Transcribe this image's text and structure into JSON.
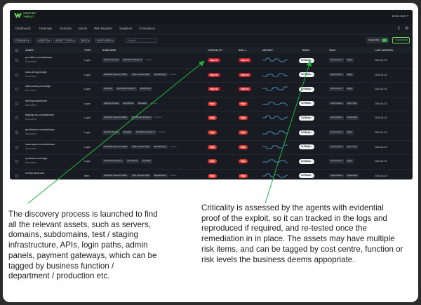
{
  "app": {
    "brand_line1": "VERIFIED",
    "brand_line2": "THREAT",
    "user_menu": "Demo User ▾"
  },
  "nav": [
    "Dashboard",
    "Heatmap",
    "Domains",
    "Assets",
    "Risk Register",
    "Suppliers",
    "Compliance"
  ],
  "nav_icons": [
    "key-icon",
    "gear-icon"
  ],
  "filters": {
    "buttons": [
      "DOMAINS ▾",
      "ASSETS ▾",
      "ASSET TYPES ▾",
      "TAGS ▾",
      "SUPPLIERS ▾"
    ],
    "search_placeholder": "Search...",
    "discovery_label": "Discovery",
    "add_asset_label": "+ Add Asset"
  },
  "columns": [
    "ASSET ↑",
    "TYPE ↑",
    "SUPPLIERS",
    "CRITICALITY",
    "RISK ▾",
    "HISTORY",
    "RISKS",
    "TAGS",
    "LAST UPDATED ↑"
  ],
  "colors": {
    "high": "#d9352b",
    "highest": "#c8202a",
    "accent": "#6ad15a",
    "arrow": "#1fb33b"
  },
  "rows": [
    {
      "asset": "pm-office.com/auth/user",
      "status": "Discovered",
      "type": "Login",
      "suppliers": [
        "Apache Tomcat",
        "WordPress Plugin V"
      ],
      "more": "6 more...",
      "criticality": "Highest",
      "risk": "Highest",
      "risks": "12 Risks",
      "tags": [
        "Cost Code A",
        "Edge"
      ],
      "updated": "2024-04-15"
    },
    {
      "asset": "www.citrx.gov/login",
      "status": "Discovered",
      "type": "Login",
      "suppliers": [
        "ASP.NET (Generic WAF)",
        "ASP Generic WAF",
        "ModSecurity"
      ],
      "more": "4 more...",
      "criticality": "Highest",
      "risk": "Highest",
      "risks": "12 Risks",
      "tags": [
        "Cost Code A",
        "Edge"
      ],
      "updated": "2024-04-15"
    },
    {
      "asset": "www.country.com/login",
      "status": "Discovered",
      "type": "Login",
      "suppliers": [
        "Redislite",
        "WordPress Plugin 3",
        "WordPress"
      ],
      "more": "",
      "criticality": "Highest",
      "risk": "Highest",
      "risks": "12 Risks",
      "tags": [
        "Cost Code A",
        "Edge"
      ],
      "updated": "2024-04-15"
    },
    {
      "asset": "electi.gov/auth/user",
      "status": "Discovered",
      "type": "Login",
      "suppliers": [
        "Apache Tomcat",
        "WordPress",
        "Redislite"
      ],
      "more": "4 more...",
      "criticality": "High",
      "risk": "High",
      "risks": "12 Risks",
      "tags": [
        "Cost Code A",
        "Test / Dev"
      ],
      "updated": "2024-04-15"
    },
    {
      "asset": "flagship.ws.com/auth/user",
      "status": "Discovered",
      "type": "Login",
      "suppliers": [
        "ASP.NET (Generic WAF)",
        "WordPress Plugin B"
      ],
      "more": "6 more...",
      "criticality": "High",
      "risk": "High",
      "risks": "14 Risks",
      "tags": [
        "Cost Code A",
        "Production"
      ],
      "updated": "2024-04-15"
    },
    {
      "asset": "gov.finance.com/auth/user",
      "status": "Discovered",
      "type": "Login",
      "suppliers": [
        "Apache Tomcat",
        "Redislite",
        "WordPress Plugin V"
      ],
      "more": "6 more...",
      "criticality": "High",
      "risk": "High",
      "risks": "12 Risks",
      "tags": [
        "Cost Code A",
        "Edge"
      ],
      "updated": "2024-04-15"
    },
    {
      "asset": "www.airport.com/auth/user",
      "status": "Discovered",
      "type": "Login",
      "suppliers": [
        "ASP.NET (Generic WAF)",
        "ASP Generic WAF",
        "ModSecurity"
      ],
      "more": "4 more...",
      "criticality": "High",
      "risk": "High",
      "risks": "11 Risks",
      "tags": [
        "Cost Code A",
        "Test / Dev"
      ],
      "updated": "2024-04-15"
    },
    {
      "asset": "syncbank.com/login",
      "status": "Discovered",
      "type": "Login",
      "suppliers": [
        "WordPress Plugin 3",
        "WordPress",
        "Redislite"
      ],
      "more": "",
      "criticality": "High",
      "risk": "High",
      "risks": "12 Risks",
      "tags": [
        "Cost Code A",
        "Edge"
      ],
      "updated": "2024-04-15"
    },
    {
      "asset": "central.bank.com",
      "status": "",
      "type": "Web",
      "suppliers": [
        "ASP.NET (Generic WAF)",
        "ASP Generic WAF",
        "ModSecurity"
      ],
      "more": "4 more...",
      "criticality": "High",
      "risk": "High",
      "risks": "12 Risks",
      "tags": [
        "Cost Code A",
        "Production"
      ],
      "updated": "2024-04-15"
    }
  ],
  "captions": {
    "left": [
      "The discovery process is launched to find",
      "all the relevant assets, such as servers,",
      "domains, subdomains, test / staging",
      "infrastructure, APIs, login paths, admin",
      "panels, payment gateways, which can be",
      "tagged by business function  /",
      "department / production etc."
    ],
    "right": [
      "Criticality is assessed by the agents with evidential",
      "proof of the exploit, so it can tracked in the logs and",
      "reproduced if required, and re-tested once the",
      "remediation in in place. The assets may have multiple",
      "risk items, and can be tagged by cost centre, function or",
      "risk levels the business deems appopriate."
    ]
  }
}
